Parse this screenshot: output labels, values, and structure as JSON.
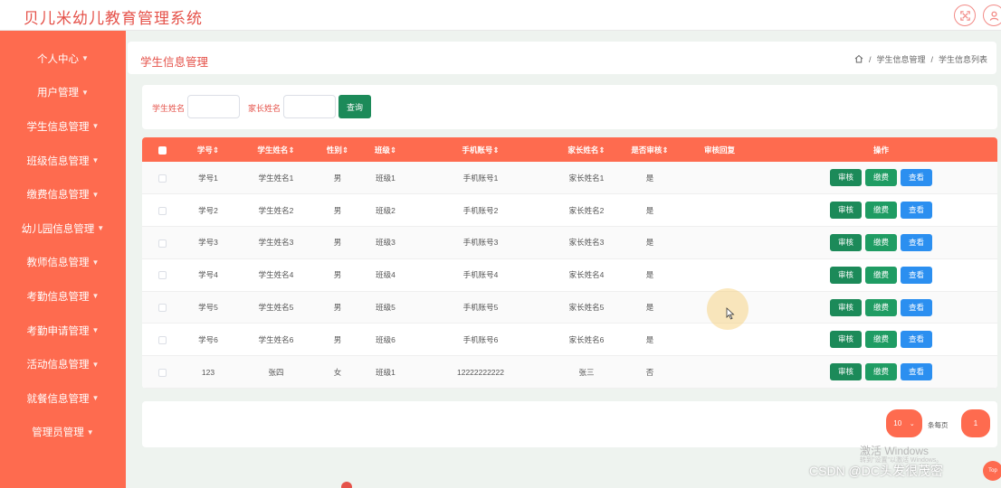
{
  "app": {
    "title": "贝儿米幼儿教育管理系统"
  },
  "topbar": {
    "icons": [
      "fullscreen-icon",
      "user-icon"
    ]
  },
  "sidebar": {
    "items": [
      {
        "label": "个人中心"
      },
      {
        "label": "用户管理"
      },
      {
        "label": "学生信息管理"
      },
      {
        "label": "班级信息管理"
      },
      {
        "label": "缴费信息管理"
      },
      {
        "label": "幼儿园信息管理"
      },
      {
        "label": "教师信息管理"
      },
      {
        "label": "考勤信息管理"
      },
      {
        "label": "考勤申请管理"
      },
      {
        "label": "活动信息管理"
      },
      {
        "label": "就餐信息管理"
      },
      {
        "label": "管理员管理"
      }
    ]
  },
  "header": {
    "title": "学生信息管理",
    "breadcrumb": [
      "学生信息管理",
      "学生信息列表"
    ],
    "separator": "/"
  },
  "search": {
    "student_label": "学生姓名",
    "student_value": "",
    "parent_label": "家长姓名",
    "parent_value": "",
    "button": "查询"
  },
  "table": {
    "columns": [
      "学号",
      "学生姓名",
      "性别",
      "班级",
      "手机账号",
      "家长姓名",
      "是否审核",
      "审核回复",
      "操作"
    ],
    "actions": {
      "review": "审核",
      "pay": "缴费",
      "view": "查看"
    },
    "rows": [
      {
        "id": "学号1",
        "name": "学生姓名1",
        "gender": "男",
        "class": "班级1",
        "phone": "手机账号1",
        "parent": "家长姓名1",
        "approved": "是",
        "reply": ""
      },
      {
        "id": "学号2",
        "name": "学生姓名2",
        "gender": "男",
        "class": "班级2",
        "phone": "手机账号2",
        "parent": "家长姓名2",
        "approved": "是",
        "reply": ""
      },
      {
        "id": "学号3",
        "name": "学生姓名3",
        "gender": "男",
        "class": "班级3",
        "phone": "手机账号3",
        "parent": "家长姓名3",
        "approved": "是",
        "reply": ""
      },
      {
        "id": "学号4",
        "name": "学生姓名4",
        "gender": "男",
        "class": "班级4",
        "phone": "手机账号4",
        "parent": "家长姓名4",
        "approved": "是",
        "reply": ""
      },
      {
        "id": "学号5",
        "name": "学生姓名5",
        "gender": "男",
        "class": "班级5",
        "phone": "手机账号5",
        "parent": "家长姓名5",
        "approved": "是",
        "reply": ""
      },
      {
        "id": "学号6",
        "name": "学生姓名6",
        "gender": "男",
        "class": "班级6",
        "phone": "手机账号6",
        "parent": "家长姓名6",
        "approved": "是",
        "reply": ""
      },
      {
        "id": "123",
        "name": "张四",
        "gender": "女",
        "class": "班级1",
        "phone": "12222222222",
        "parent": "张三",
        "approved": "否",
        "reply": ""
      }
    ]
  },
  "pagination": {
    "page_size": "10",
    "per_page_label": "条每页",
    "current_page": "1"
  },
  "overlay": {
    "windows_watermark": "激活 Windows",
    "windows_sub": "转到\"设置\"以激活 Windows。",
    "csdn": "CSDN @DC头发很茂密",
    "top_button": "Top"
  },
  "colors": {
    "accent": "#fe6b4f",
    "title": "#e5524a",
    "green": "#1c8a59",
    "blue": "#2b8ff0"
  }
}
